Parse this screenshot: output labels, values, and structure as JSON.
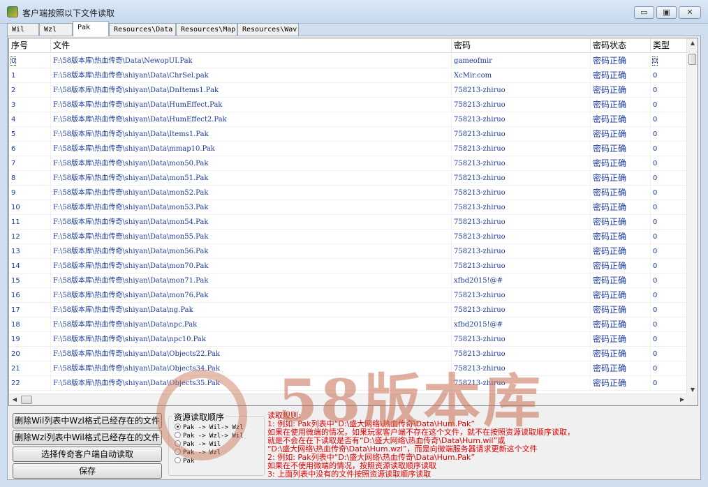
{
  "window": {
    "title": "客户端按照以下文件读取",
    "minimize_label": "▭",
    "maximize_label": "▣",
    "close_label": "✕"
  },
  "tabs": [
    {
      "label": "Wil",
      "active": false
    },
    {
      "label": "Wzl",
      "active": false
    },
    {
      "label": "Pak",
      "active": true
    },
    {
      "label": "Resources\\Data",
      "active": false
    },
    {
      "label": "Resources\\Map",
      "active": false
    },
    {
      "label": "Resources\\Wav",
      "active": false
    }
  ],
  "table": {
    "columns": [
      "序号",
      "文件",
      "密码",
      "密码状态",
      "类型"
    ],
    "rows": [
      [
        "0",
        "F:\\58版本库\\热血传奇\\Data\\NewopUI.Pak",
        "gameofmir",
        "密码正确",
        "0"
      ],
      [
        "1",
        "F:\\58版本库\\热血传奇\\shiyan\\Data\\ChrSel.pak",
        "XcMir.com",
        "密码正确",
        "0"
      ],
      [
        "2",
        "F:\\58版本库\\热血传奇\\shiyan\\Data\\DnItems1.Pak",
        "758213-zhiruo",
        "密码正确",
        "0"
      ],
      [
        "3",
        "F:\\58版本库\\热血传奇\\shiyan\\Data\\HumEffect.Pak",
        "758213-zhiruo",
        "密码正确",
        "0"
      ],
      [
        "4",
        "F:\\58版本库\\热血传奇\\shiyan\\Data\\HumEffect2.Pak",
        "758213-zhiruo",
        "密码正确",
        "0"
      ],
      [
        "5",
        "F:\\58版本库\\热血传奇\\shiyan\\Data\\Items1.Pak",
        "758213-zhiruo",
        "密码正确",
        "0"
      ],
      [
        "6",
        "F:\\58版本库\\热血传奇\\shiyan\\Data\\mmap10.Pak",
        "758213-zhiruo",
        "密码正确",
        "0"
      ],
      [
        "7",
        "F:\\58版本库\\热血传奇\\shiyan\\Data\\mon50.Pak",
        "758213-zhiruo",
        "密码正确",
        "0"
      ],
      [
        "8",
        "F:\\58版本库\\热血传奇\\shiyan\\Data\\mon51.Pak",
        "758213-zhiruo",
        "密码正确",
        "0"
      ],
      [
        "9",
        "F:\\58版本库\\热血传奇\\shiyan\\Data\\mon52.Pak",
        "758213-zhiruo",
        "密码正确",
        "0"
      ],
      [
        "10",
        "F:\\58版本库\\热血传奇\\shiyan\\Data\\mon53.Pak",
        "758213-zhiruo",
        "密码正确",
        "0"
      ],
      [
        "11",
        "F:\\58版本库\\热血传奇\\shiyan\\Data\\mon54.Pak",
        "758213-zhiruo",
        "密码正确",
        "0"
      ],
      [
        "12",
        "F:\\58版本库\\热血传奇\\shiyan\\Data\\mon55.Pak",
        "758213-zhiruo",
        "密码正确",
        "0"
      ],
      [
        "13",
        "F:\\58版本库\\热血传奇\\shiyan\\Data\\mon56.Pak",
        "758213-zhiruo",
        "密码正确",
        "0"
      ],
      [
        "14",
        "F:\\58版本库\\热血传奇\\shiyan\\Data\\mon70.Pak",
        "758213-zhiruo",
        "密码正确",
        "0"
      ],
      [
        "15",
        "F:\\58版本库\\热血传奇\\shiyan\\Data\\mon71.Pak",
        "xfbd2015!@#",
        "密码正确",
        "0"
      ],
      [
        "16",
        "F:\\58版本库\\热血传奇\\shiyan\\Data\\mon76.Pak",
        "758213-zhiruo",
        "密码正确",
        "0"
      ],
      [
        "17",
        "F:\\58版本库\\热血传奇\\shiyan\\Data\\ng.Pak",
        "758213-zhiruo",
        "密码正确",
        "0"
      ],
      [
        "18",
        "F:\\58版本库\\热血传奇\\shiyan\\Data\\npc.Pak",
        "xfbd2015!@#",
        "密码正确",
        "0"
      ],
      [
        "19",
        "F:\\58版本库\\热血传奇\\shiyan\\Data\\npc10.Pak",
        "758213-zhiruo",
        "密码正确",
        "0"
      ],
      [
        "20",
        "F:\\58版本库\\热血传奇\\shiyan\\Data\\Objects22.Pak",
        "758213-zhiruo",
        "密码正确",
        "0"
      ],
      [
        "21",
        "F:\\58版本库\\热血传奇\\shiyan\\Data\\Objects34.Pak",
        "758213-zhiruo",
        "密码正确",
        "0"
      ],
      [
        "22",
        "F:\\58版本库\\热血传奇\\shiyan\\Data\\Objects35.Pak",
        "758213-zhiruo",
        "密码正确",
        "0"
      ]
    ]
  },
  "buttons": {
    "delete_wil": "删除Wil列表中Wzl格式已经存在的文件",
    "delete_wzl": "删除Wzl列表中Wil格式已经存在的文件",
    "select_client": "选择传奇客户端自动读取",
    "save": "保存"
  },
  "resource_order": {
    "title": "资源读取顺序",
    "options": [
      {
        "label": "Pak -> Wil-> Wzl",
        "selected": true
      },
      {
        "label": "Pak -> Wzl-> Wil",
        "selected": false
      },
      {
        "label": "Pak -> Wil",
        "selected": false
      },
      {
        "label": "Pak -> Wzl",
        "selected": false
      },
      {
        "label": "Pak",
        "selected": false
      }
    ]
  },
  "rules": {
    "lines": [
      "读取规则:",
      "1: 例如: Pak列表中“D:\\盛大网络\\热血传奇\\Data\\Hum.Pak”",
      "     如果在使用微端的情况，如果玩家客户端不存在这个文件，就不在按照资源读取顺序读取，",
      "     就是不会在在下读取是否有“D:\\盛大网络\\热血传奇\\Data\\Hum.wil”或",
      "     “D:\\盛大网络\\热血传奇\\Data\\Hum.wzl”，而是向微端服务器请求更新这个文件",
      "2: 例如: Pak列表中“D:\\盛大网络\\热血传奇\\Data\\Hum.Pak”",
      "     如果在不使用微端的情况，按照资源读取顺序读取",
      "3: 上面列表中没有的文件按照资源读取顺序读取"
    ]
  },
  "watermark": {
    "text": "58版本库"
  },
  "colors": {
    "link_blue": "#1a3a9c",
    "rule_red": "#e00000",
    "watermark": "#c86e50"
  }
}
